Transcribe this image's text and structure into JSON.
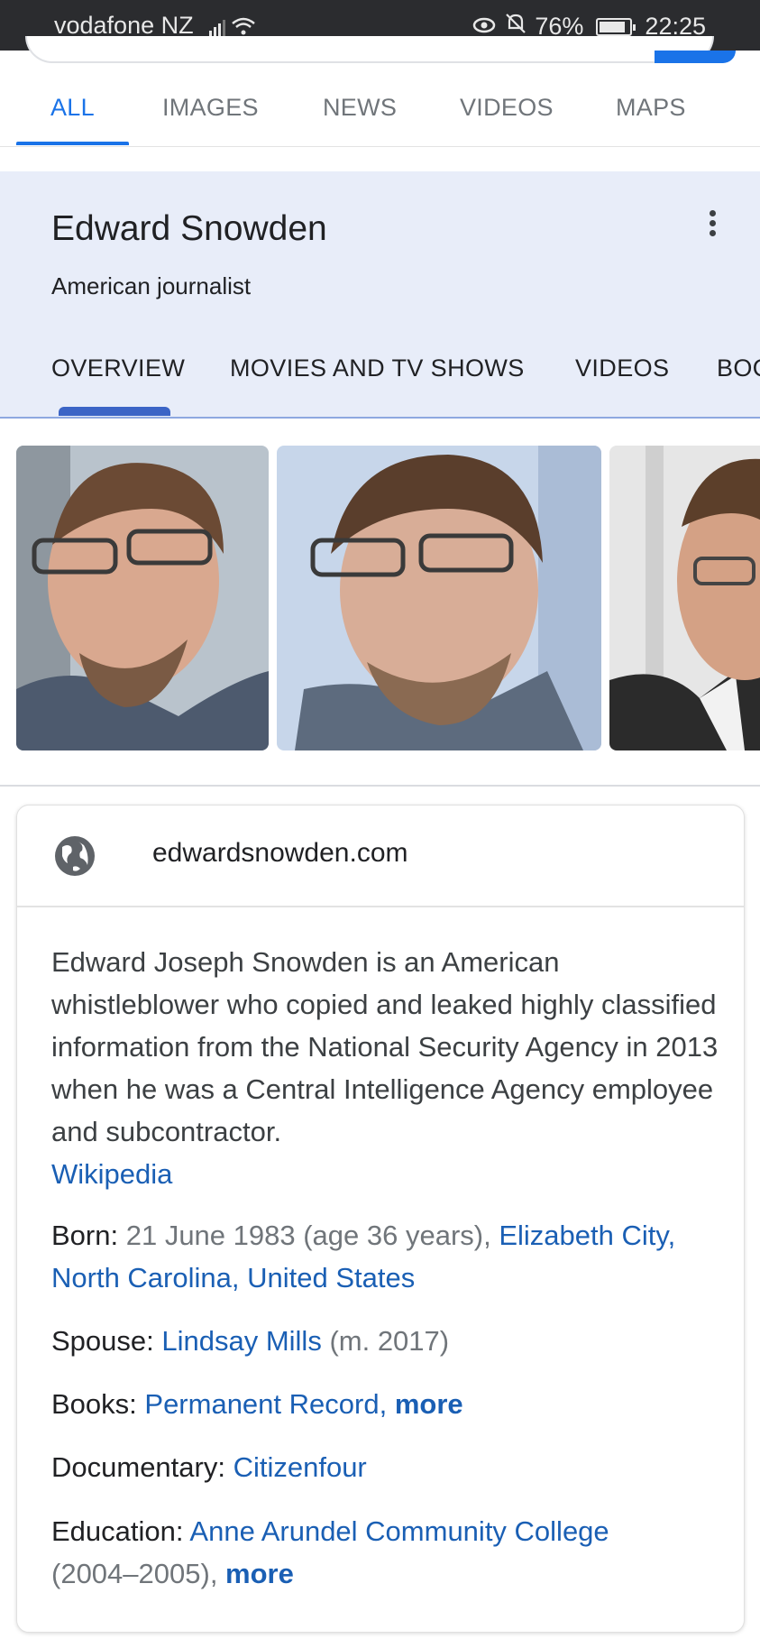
{
  "status_bar": {
    "carrier": "vodafone NZ",
    "battery": "76%",
    "battery_level": 0.76,
    "time": "22:25"
  },
  "top_tabs": [
    "ALL",
    "IMAGES",
    "NEWS",
    "VIDEOS",
    "MAPS"
  ],
  "active_top_tab": "ALL",
  "knowledge_panel": {
    "title": "Edward Snowden",
    "subtitle": "American journalist",
    "tabs": [
      "OVERVIEW",
      "MOVIES AND TV SHOWS",
      "VIDEOS",
      "BOO"
    ],
    "active_tab": "OVERVIEW"
  },
  "card": {
    "website": "edwardsnowden.com",
    "description": "Edward Joseph Snowden is an American whistleblower who copied and leaked highly classified information from the National Security Agency in 2013 when he was a Central Intelligence Agency employee and subcontractor.",
    "description_source": "Wikipedia",
    "facts": {
      "born_label": "Born: ",
      "born_value": "21 June 1983 (age 36 years), ",
      "born_link": "Elizabeth City, North Carolina, United States",
      "spouse_label": "Spouse: ",
      "spouse_link": "Lindsay Mills",
      "spouse_value": " (m. 2017)",
      "books_label": "Books: ",
      "books_link": "Permanent Record, ",
      "books_more": "more",
      "documentary_label": "Documentary: ",
      "documentary_link": "Citizenfour",
      "education_label": "Education: ",
      "education_link": "Anne Arundel Community College",
      "education_value": "(2004–2005), ",
      "education_more": "more"
    }
  },
  "colors": {
    "accent_blue": "#1a73e8",
    "link_blue": "#1a5fb4",
    "panel_bg": "#e8edf9"
  }
}
